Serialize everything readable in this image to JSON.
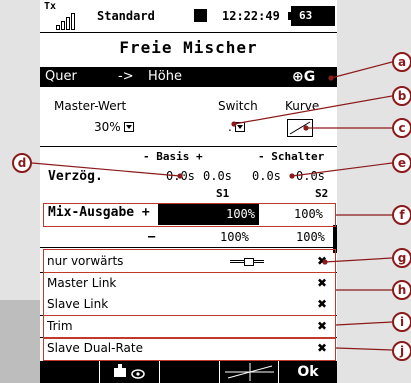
{
  "status": {
    "tx_label": "Tx",
    "model_name": "Standard",
    "time": "12:22:49",
    "battery": "63"
  },
  "title": "Freie Mischer",
  "mixer": {
    "from": "Quer",
    "arrow": "->",
    "to": "Höhe",
    "icon_text": "⊕G"
  },
  "master": {
    "master_label": "Master-Wert",
    "switch_label": "Switch",
    "curve_label": "Kurve",
    "master_value": "30%",
    "switch_value": "."
  },
  "delay": {
    "basis_header": "- Basis +",
    "schalter_header": "- Schalter",
    "label": "Verzög.",
    "basis_minus": "0.0s",
    "basis_plus": "0.0s",
    "schalter_minus": "0.0s",
    "schalter_plus": "0.0s",
    "s1": "S1",
    "s2": "S2"
  },
  "mix_output": {
    "label": "Mix-Ausgabe +",
    "plus_s1": "100%",
    "plus_s2": "100%",
    "minus_label": "—",
    "minus_s1": "100%",
    "minus_s2": "100%"
  },
  "options": [
    {
      "label": "nur vorwärts",
      "value": "✖"
    },
    {
      "label": "Master Link",
      "value": "✖"
    },
    {
      "label": "Slave Link",
      "value": "✖"
    },
    {
      "label": "Trim",
      "value": "✖"
    },
    {
      "label": "Slave Dual-Rate",
      "value": "✖"
    }
  ],
  "bottom": {
    "ok": "Ok"
  },
  "callouts": [
    "a",
    "b",
    "c",
    "d",
    "e",
    "f",
    "g",
    "h",
    "i",
    "j"
  ],
  "colors": {
    "callout": "#8b1a1a",
    "screen_bg": "#ffffff",
    "highlight": "#000000"
  }
}
